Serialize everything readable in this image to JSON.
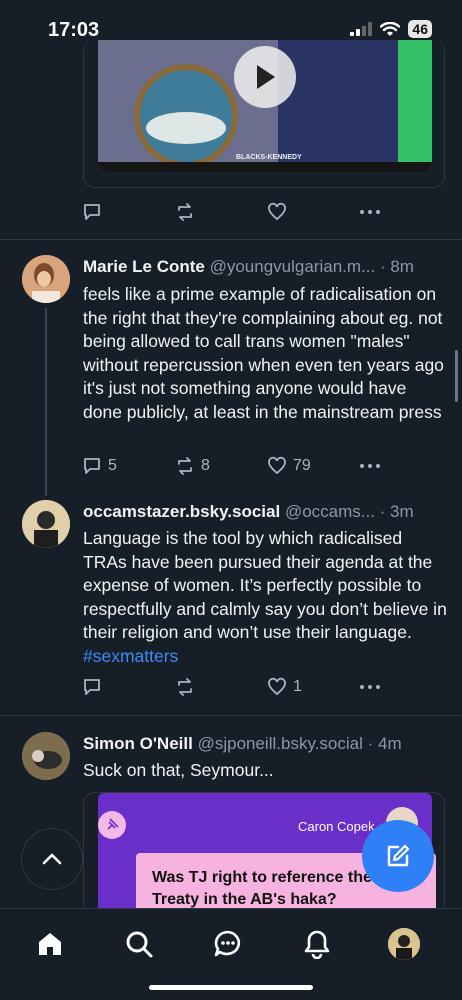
{
  "status_bar": {
    "time": "17:03",
    "battery": "46"
  },
  "video": {
    "caption": "BLACKS-KENNEDY"
  },
  "posts": [
    {
      "name": "Marie Le Conte",
      "handle": "@youngvulgarian.m...",
      "time": "· 8m",
      "text": "feels like a prime example of radicalisation on the right that they're complaining about eg. not being allowed to call trans women \"males\" without repercussion when even ten years ago it's just not something anyone would have done publicly, at least in the mainstream press",
      "replies": "5",
      "reposts": "8",
      "likes": "79"
    },
    {
      "name": "occamstazer.bsky.social",
      "handle": "@occams...",
      "time": "· 3m",
      "text": "Language is the tool by which radicalised TRAs have been pursued their agenda at the expense of women. It’s perfectly possible to respectfully and calmly say you don’t believe in their religion and won’t use their language.",
      "hashtag": "#sexmatters",
      "replies": "",
      "reposts": "",
      "likes": "1"
    },
    {
      "name": "Simon O'Neill",
      "handle": "@sjponeill.bsky.social",
      "time": "· 4m",
      "text": "Suck on that, Seymour..."
    }
  ],
  "embed": {
    "author": "Caron Copek",
    "question": "Was TJ right to reference the Treaty in the AB's haka?"
  },
  "tabs": [
    "home-icon",
    "search-icon",
    "chat-icon",
    "bell-icon",
    "profile-avatar"
  ],
  "colors": {
    "background": "#161e27",
    "accent": "#2f80f7",
    "hashtag": "#3d8cf5",
    "muted": "#8b98a5"
  }
}
